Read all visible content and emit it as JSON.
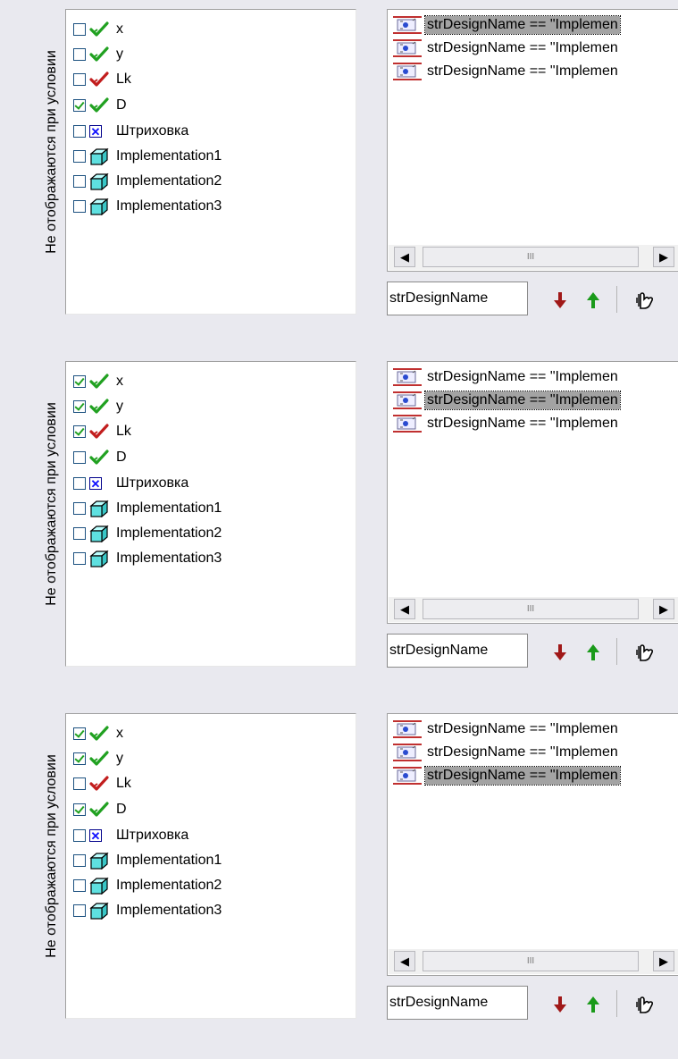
{
  "label": "Не отображаются при условии",
  "items": [
    "x",
    "y",
    "Lk",
    "D",
    "Штриховка",
    "Implementation1",
    "Implementation2",
    "Implementation3"
  ],
  "item_icons": [
    "green-check-icon",
    "green-check-icon",
    "red-check-icon",
    "green-check-icon",
    "hatch-x-icon",
    "component-cube-icon",
    "component-cube-icon",
    "component-cube-icon"
  ],
  "condition_text": "strDesignName == \"Implemen",
  "field_value": "strDesignName",
  "scroll_grip": "III",
  "colors": {
    "check_green": "#21a121",
    "check_red": "#c21e1e",
    "arrow_down": "#a01818",
    "arrow_up": "#1a9a1a",
    "selection": "#a3a3a3"
  },
  "panels": [
    {
      "checked": [
        false,
        false,
        false,
        true,
        false,
        false,
        false,
        false
      ],
      "selected": 0
    },
    {
      "checked": [
        true,
        true,
        true,
        false,
        false,
        false,
        false,
        false
      ],
      "selected": 1
    },
    {
      "checked": [
        true,
        true,
        false,
        true,
        false,
        false,
        false,
        false
      ],
      "selected": 2
    }
  ]
}
